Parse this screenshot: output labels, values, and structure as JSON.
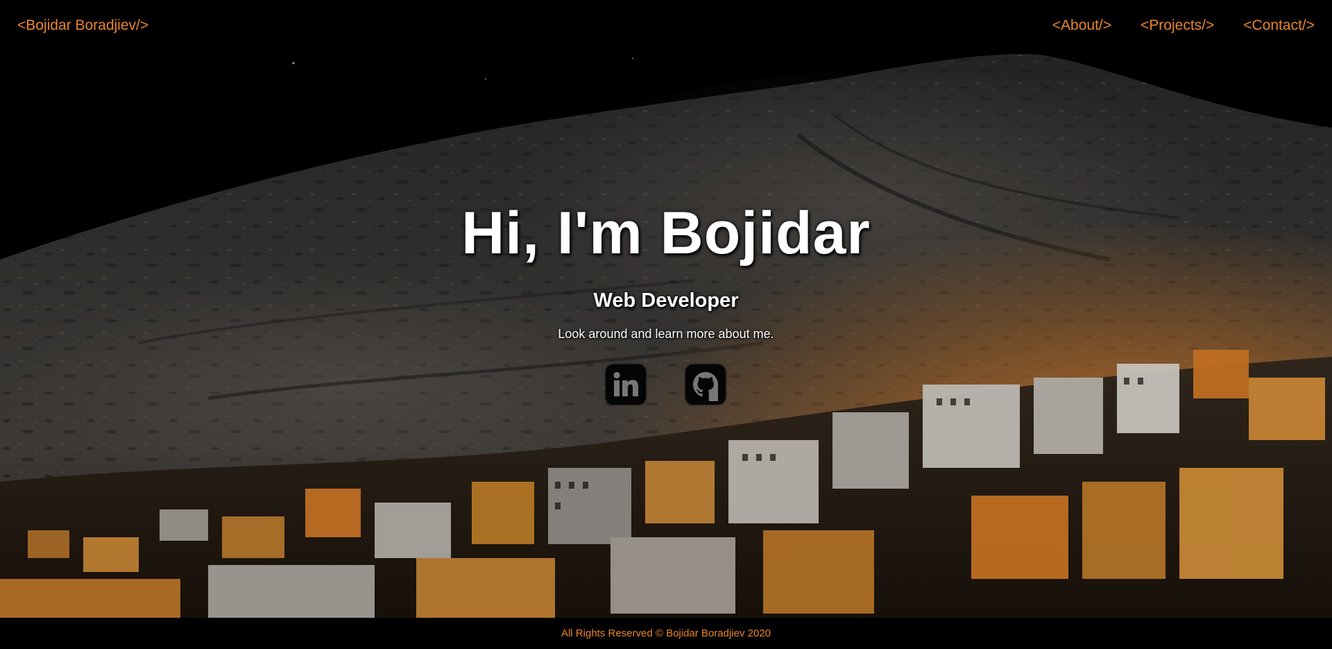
{
  "navbar": {
    "brand": "<Bojidar Boradjiev/>",
    "links": [
      {
        "label": "<About/>"
      },
      {
        "label": "<Projects/>"
      },
      {
        "label": "<Contact/>"
      }
    ]
  },
  "hero": {
    "title": "Hi, I'm Bojidar",
    "subtitle": "Web Developer",
    "tagline": "Look around and learn more about me.",
    "social": [
      {
        "icon": "linkedin-icon"
      },
      {
        "icon": "github-icon"
      }
    ]
  },
  "footer": {
    "text": "All Rights Reserved © Bojidar Boradjiev 2020"
  },
  "colors": {
    "accent": "#e8862a",
    "background": "#000000",
    "hero_text": "#ffffff"
  }
}
